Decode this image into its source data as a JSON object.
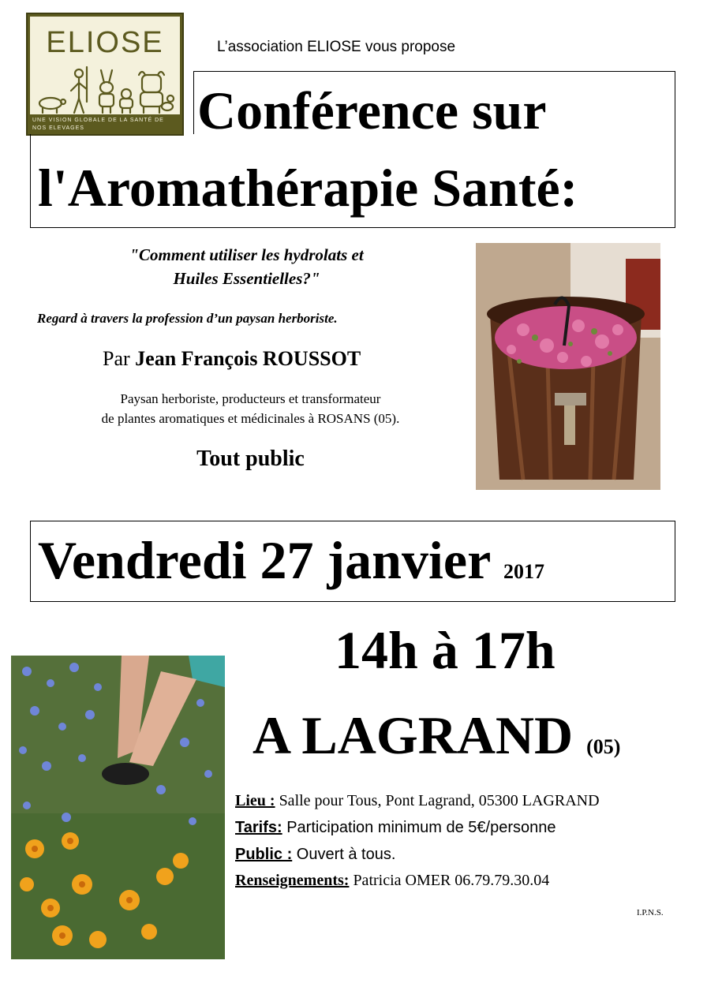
{
  "logo": {
    "wordmark": "ELIOSE",
    "tagline": "une vision globale de la santé de nos elevages"
  },
  "header": {
    "association": "L’association ELIOSE  vous propose"
  },
  "title": {
    "line1": "Conférence sur",
    "line2": "l'Aromathérapie Santé:"
  },
  "subtitle": {
    "question_line1": "\"Comment utiliser les hydrolats et",
    "question_line2": "Huiles Essentielles?\"",
    "regard_prefix": "Regard à travers la profession d’",
    "regard_un": "un",
    "regard_suffix": " paysan herboriste."
  },
  "speaker": {
    "par": "Par ",
    "name": "Jean François ROUSSOT",
    "bio_line1": "Paysan herboriste, producteurs et transformateur",
    "bio_line2": "de plantes aromatiques et médicinales à  ROSANS (05)."
  },
  "audience": "Tout public",
  "event": {
    "date": "Vendredi 27 janvier ",
    "year": "2017",
    "time": "14h à 17h",
    "place": "A LAGRAND ",
    "department": "(05)"
  },
  "details": {
    "lieu_label": "Lieu :",
    "lieu_value": " Salle pour Tous, Pont Lagrand, ",
    "lieu_postal": "05300 LAGRAND",
    "tarifs_label": "Tarifs:",
    "tarifs_value": " Participation minimum de 5€/personne",
    "public_label": "Public :",
    "public_value": " Ouvert à tous.",
    "renseignements_label": "Renseignements:",
    "renseignements_value": " Patricia OMER 06.79.79.30.04"
  },
  "footer": {
    "ipns": "I.P.N.S."
  }
}
